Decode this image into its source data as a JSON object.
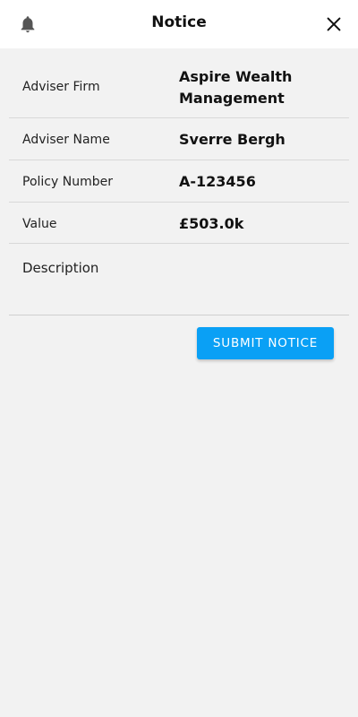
{
  "header": {
    "title": "Notice",
    "left_icon": "bell-icon",
    "right_icon": "close-icon"
  },
  "details": [
    {
      "label": "Adviser Firm",
      "value": "Aspire Wealth Management"
    },
    {
      "label": "Adviser Name",
      "value": "Sverre Bergh"
    },
    {
      "label": "Policy Number",
      "value": "A-123456"
    },
    {
      "label": "Value",
      "value": "£503.0k"
    }
  ],
  "description": {
    "label": "Description"
  },
  "actions": {
    "submit_label": "SUBMIT NOTICE"
  },
  "colors": {
    "background": "#f2f2f2",
    "header_background": "#ffffff",
    "accent": "#0aa0f5",
    "divider": "#d8d8d8"
  }
}
